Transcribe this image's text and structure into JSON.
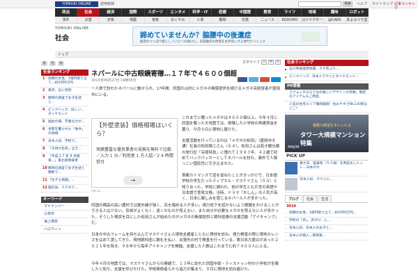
{
  "header": {
    "logo": "YOMIURI ONLINE",
    "logo_sub": "読売新聞",
    "search_button": "検索",
    "links": [
      "ヘルプ",
      "サイトマップ",
      "記事ランキング"
    ]
  },
  "nav_main": [
    "政治",
    "社会",
    "経済",
    "国際",
    "スポーツ",
    "エンタメ",
    "科学・IT",
    "医療",
    "中国語",
    "教育",
    "ライフ",
    "地域",
    "趣味",
    "ロボット"
  ],
  "nav_sub": [
    "事件",
    "災害",
    "天気",
    "地震",
    "気象",
    "おくやみ",
    "人事",
    "動物",
    "交通",
    "ニュース",
    "KODOMO",
    "ヨミドクター",
    "@CARS",
    "本よみうり堂"
  ],
  "brand": "YOMIURI ONLINE",
  "section_title": "社会",
  "ad_banner": {
    "title": "諦めていませんか？脇腰中の後遺症",
    "subtitle": "筋肉のつっぱり軽くしリハビリの助けに。日常動作の改善をお手伝いする専門クリニック"
  },
  "breadcrumb": "トップ",
  "left_sidebar": {
    "home_icons": [
      "会",
      "社",
      "会"
    ],
    "ranking_header": "社会ランキング",
    "ranking": [
      "前橋の女性、1億円取り立て…約1000万円",
      "東京、石に突然",
      "教師の調査で女子生徒と...",
      "ピンクバッグ、妖しい...ダイヤモンド",
      "国会の場、学者の力が...",
      "世間を驚かせた「事件」の真相",
      "日本人初、学校で...",
      "「子供が急死」泣き...",
      "「平成 2 7 年 9 月関東...」東北豪雨被害",
      "教師の調査で女子生徒と無断で...",
      "「生きる価値」...",
      "国交省、スマホで..."
    ],
    "keyword_header": "キーワード",
    "keywords": [
      "マイナンバー",
      "小林市",
      "海上保安",
      "ハロウィン"
    ]
  },
  "article": {
    "text_size_label": "文字サイズ",
    "text_size_buttons": [
      "小",
      "中",
      "大"
    ],
    "headline": "ネパールに中古眼鏡寄贈…１７年で４６００個超",
    "date": "2015年09月27日 16時56分",
    "lead": "一人旅で訪れたネパールに魅せられ、17年間、同国の山村にメガネの無償提供を続けるメガネ店経営者が盛岡市にいる。",
    "inline_ad": {
      "title": "【外壁塗装】価格相場はいくら？",
      "body": "実績豊富な優良業者の見積を無料で比較／入力 1 分／利用者 1 万人超／2 4 時間受付",
      "arrow": "→",
      "credit": "Ads by ..."
    },
    "para1": "これまでに贈ったメガネは４６００個以上。今年４月に同国を襲った大地震では、倒壊した小学校の再建資金を募り、今月９日に現地に届けた。",
    "para2": "支援活動を行っているのは「メガネの松田」（盛岡市大通）社長の松田陽二さん（６４）。松田さんは若き観光都の旅行記「深夜特急」に憧れて１９９３年、４２歳で初めてバックパッカーとしてネパールを訪れ、素朴で人懐っこい国民性に引き込まれた。",
    "para3": "首都カトマンズで道を尋ねたことがきっかけで、日本語学校の学生だったディプカル・マスケイさん（５０）と知り合った。学校に誘われ、他の学生とも片言の英語や日本語で意見交換。当時、ドラマ「おしん」の人気が高く、日本に親しみを感じるネパール人が多かった。",
    "para4": "同国の標高の高い農村では紫外線が強く、目を傷める人が多い。視力低下を招かないよう眼鏡をかけることができる人は少ない。気候がよくなく、遠くのものが見えない、また自分が必要なメガネを買えない人が多かった。そうした現状を目にした松田さんが始めたのがメガネの無償提供と眼科医療の支援活動「アイキャンプ」だ。",
    "para5": "日本の中古フレームを持ち込んでマスケイさんら現地支援者とともに現地を訪ね、視力検査の際に現地のレンズをはめて渡してきた。現地眼科医に謝礼を払い、出張先の村で検査を行っている。東日本大震災があった２０１１年を除き、９８年から毎年アイキャンプを開催。支援した人数はこれまでに約７４００人に上る。",
    "para6": "今年４月の地震では、マスケイさんからの連絡で、１３年に訪れた同国中部・ティストゥン村の小学校が全壊したと知り、支援を呼びかけた。学校関係者らから協力が集まり、９月に現地を訪ね届けた。"
  },
  "right_sidebar": {
    "news_header": "社会ランキング",
    "news": [
      "石川県奥能登地震、６６年ぶり...",
      "ピンクバッグ、日本人でやっとダイヤモンド..."
    ],
    "pr_header": "PR情報",
    "pr_items": [
      "スウォッチならではの楽しいデザインが多数。限定のアイテムもご用意。",
      "人気の住宅エリア徹底解剖！住みやすさNo.1の街はどこ？"
    ],
    "tower_ad": {
      "sub": "優雅な眺望を手に入れる",
      "title": "タワー大規模マンション特集",
      "brand": "MAJOR"
    },
    "pickup_header": "PICK UP",
    "pickup_items": [
      "東大卒、医薬系（５３歳）を商品化しヒット…日本の今",
      "日本人初、サウジ人..."
    ],
    "blog_tabs": [
      "ブログ",
      "社会",
      "生活"
    ],
    "blog_count": "3019",
    "blog_items": [
      "前橋の女性、1億円取り立て…約1000万円...",
      "学校の「声」、声がけ…と...",
      "日本人初、日本人の女子と...",
      "日本人の物人…教育家..."
    ]
  }
}
